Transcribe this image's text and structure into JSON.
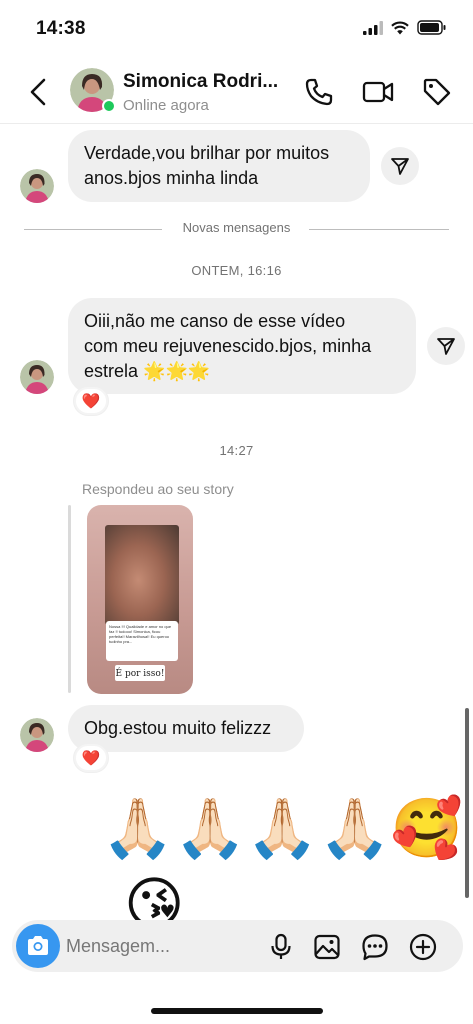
{
  "status_bar": {
    "time": "14:38"
  },
  "header": {
    "contact_name": "Simonica Rodri...",
    "contact_status": "Online agora"
  },
  "chat": {
    "message_1": {
      "line1": "Verdade,vou brilhar por muitos",
      "line2": "anos.bjos minha linda"
    },
    "new_messages_divider": "Novas mensagens",
    "timestamp_1": "ONTEM, 16:16",
    "message_2": {
      "line1": "Oiii,não me canso de esse vídeo",
      "line2": "com meu rejuvenescido.bjos, minha",
      "line3": "estrela 🌟🌟🌟"
    },
    "message_2_reaction": "❤️",
    "timestamp_2": "14:27",
    "story_reply_label": "Respondeu ao seu story",
    "story": {
      "caption": "É por isso!",
      "comment_text": "Nossa !!! Qualidade e amor no que faz !! tudooo! Simonica, ficou perfeita!! Maravilhosa!! Eu queroo tudinho pra..."
    },
    "message_3": "Obg.estou muito felizzz",
    "message_3_reaction": "❤️",
    "emoji_message_1": "🙏🏻🙏🏻🙏🏻🙏🏻🥰",
    "emoji_message_2": "😘"
  },
  "composer": {
    "placeholder": "Mensagem..."
  },
  "colors": {
    "accent": "#3797f0",
    "online": "#1ec95b",
    "bubble": "#efefef"
  }
}
